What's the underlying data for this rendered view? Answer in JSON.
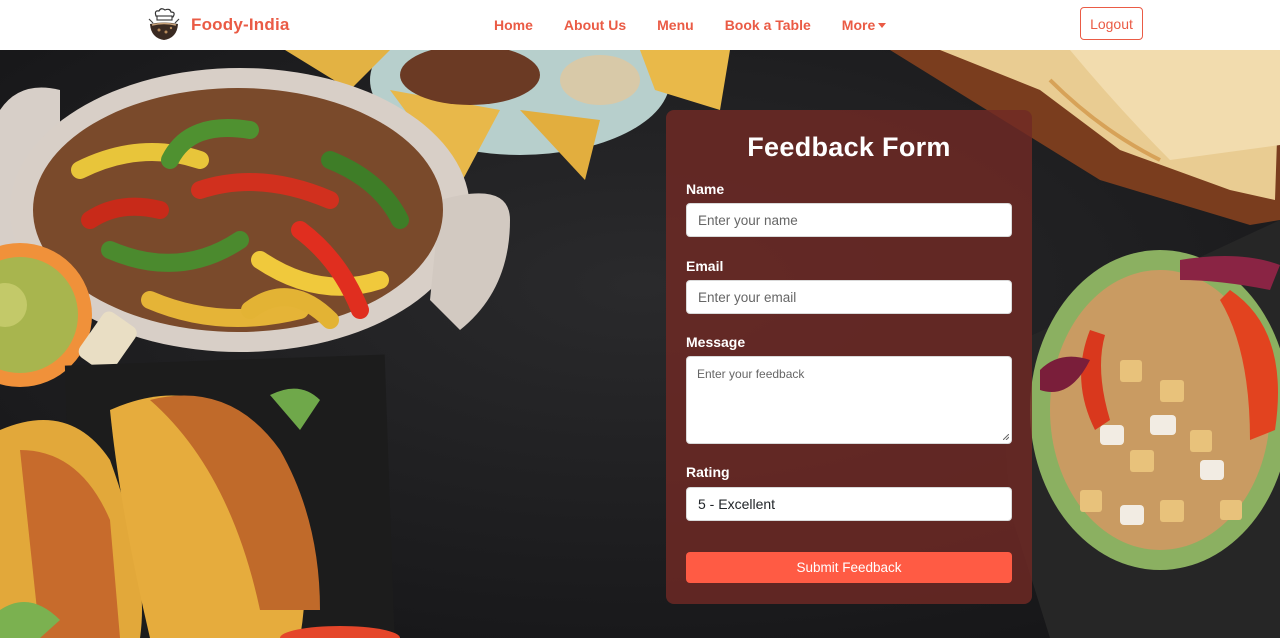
{
  "brand": {
    "name": "Foody-India",
    "logo_icon": "chef-hat-logo"
  },
  "nav": {
    "links": [
      "Home",
      "About Us",
      "Menu",
      "Book a Table",
      "More"
    ],
    "more_dropdown_icon": "caret-down-icon",
    "logout_label": "Logout"
  },
  "form": {
    "title": "Feedback Form",
    "name": {
      "label": "Name",
      "placeholder": "Enter your name",
      "value": ""
    },
    "email": {
      "label": "Email",
      "placeholder": "Enter your email",
      "value": ""
    },
    "message": {
      "label": "Message",
      "placeholder": "Enter your feedback",
      "value": ""
    },
    "rating": {
      "label": "Rating",
      "selected": "5 - Excellent"
    },
    "submit_label": "Submit Feedback"
  },
  "colors": {
    "accent": "#ea5b45",
    "button": "#ff5b44",
    "card": "#702a24",
    "background": "#1f1f21"
  }
}
